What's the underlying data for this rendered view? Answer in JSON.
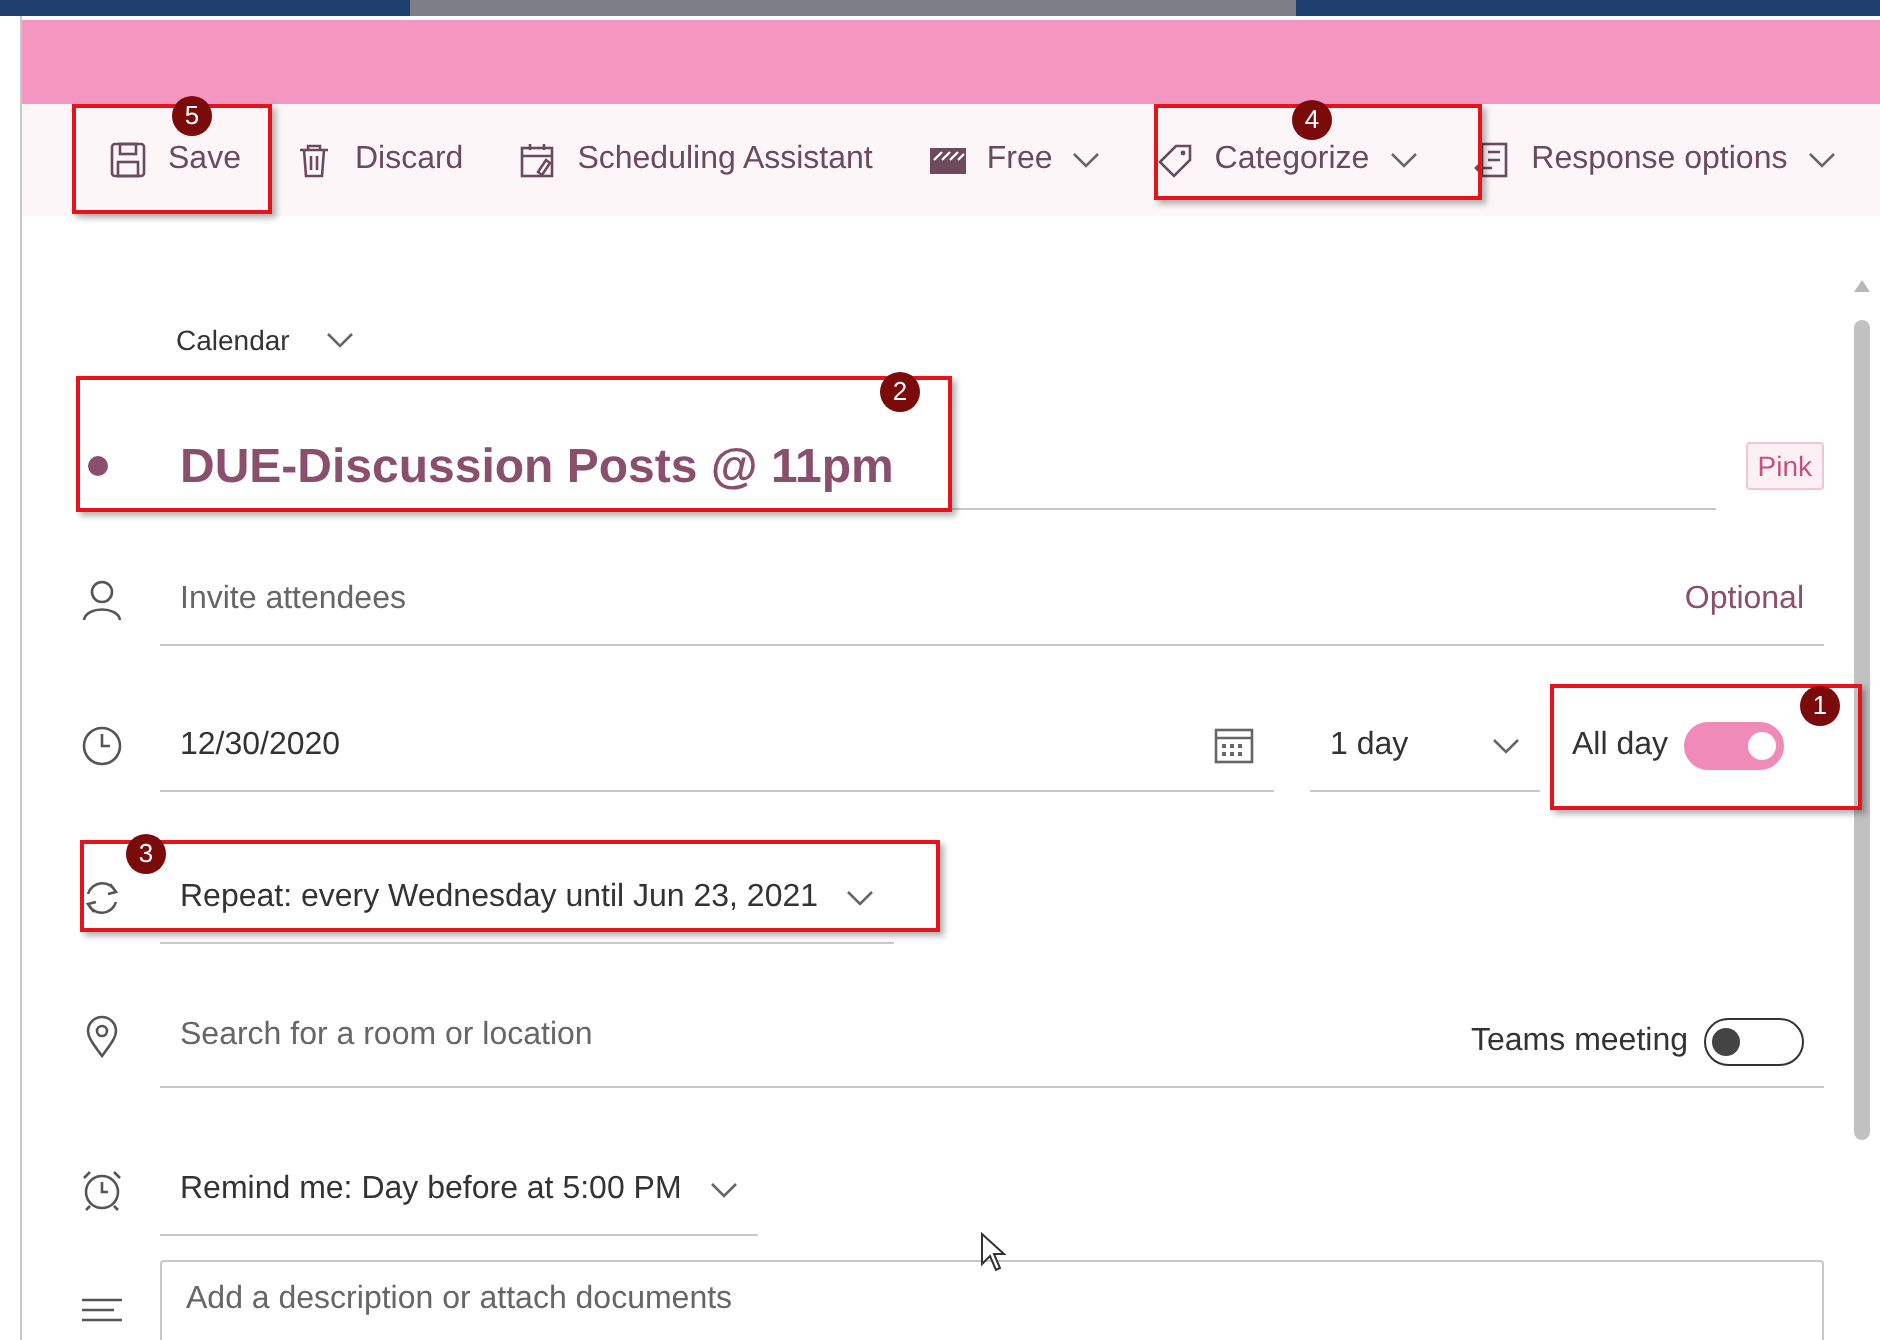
{
  "toolbar": [
    {
      "label": "Save",
      "dropdown": false
    },
    {
      "label": "Discard",
      "dropdown": false
    },
    {
      "label": "Scheduling Assistant",
      "dropdown": false
    },
    {
      "label": "Free",
      "dropdown": true
    },
    {
      "label": "Categorize",
      "dropdown": true
    },
    {
      "label": "Response options",
      "dropdown": true
    }
  ],
  "form": {
    "calendar": {
      "label": "Calendar"
    },
    "title": {
      "value": "DUE-Discussion Posts @ 11pm"
    },
    "category_tag": "Pink",
    "attendees": {
      "placeholder": "Invite attendees",
      "optional_link": "Optional"
    },
    "date": {
      "value": "12/30/2020"
    },
    "duration": {
      "value": "1 day"
    },
    "all_day": {
      "label": "All day",
      "on": true
    },
    "repeat": {
      "value": "Repeat:  every Wednesday until Jun 23, 2021"
    },
    "location": {
      "placeholder": "Search for a room or location"
    },
    "teams_meeting": {
      "label": "Teams meeting",
      "on": false
    },
    "reminder": {
      "value": "Remind me:  Day before at 5:00 PM"
    },
    "description": {
      "placeholder": "Add a description or attach documents"
    }
  },
  "annotations": [
    {
      "number": "5"
    },
    {
      "number": "4"
    },
    {
      "number": "2"
    },
    {
      "number": "1"
    },
    {
      "number": "3"
    }
  ]
}
